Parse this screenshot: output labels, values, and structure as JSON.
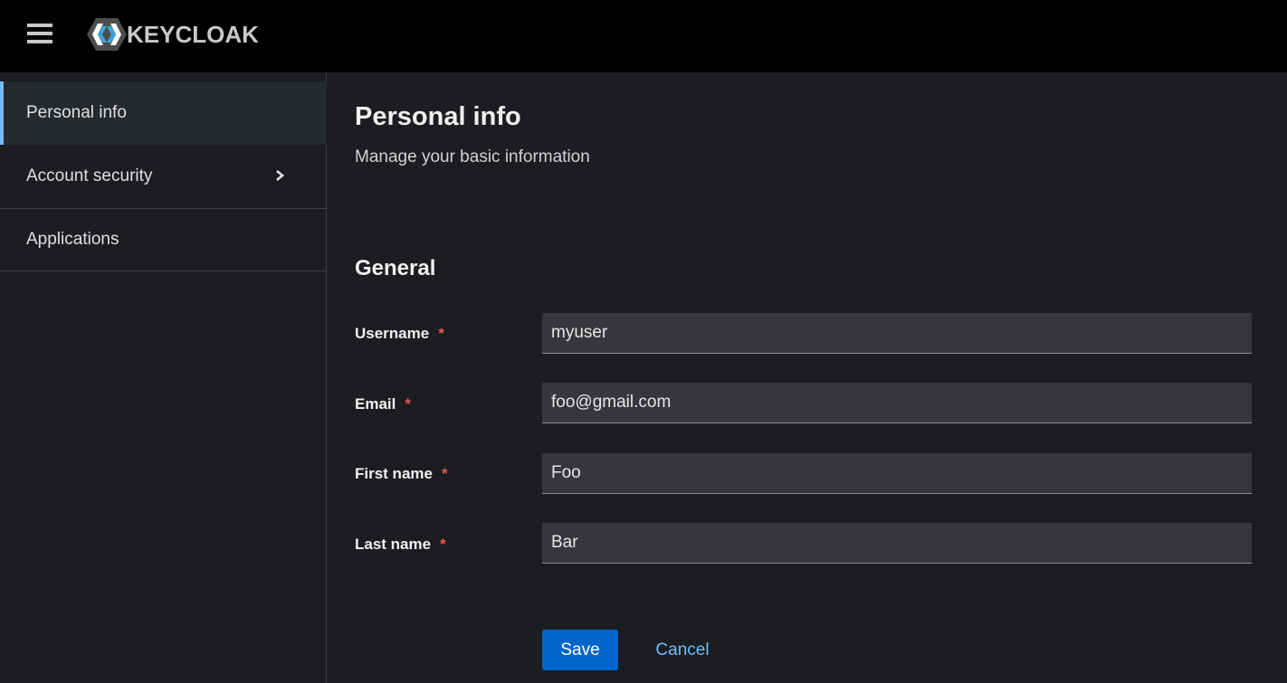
{
  "app": {
    "logo_text": "KEYCLOAK"
  },
  "sidebar": {
    "items": [
      {
        "label": "Personal info",
        "active": true
      },
      {
        "label": "Account security",
        "expandable": true
      },
      {
        "label": "Applications"
      }
    ]
  },
  "main": {
    "title": "Personal info",
    "subtitle": "Manage your basic information",
    "section_title": "General",
    "fields": [
      {
        "label": "Username",
        "required_mark": "*",
        "value": "myuser"
      },
      {
        "label": "Email",
        "required_mark": "*",
        "value": "foo@gmail.com"
      },
      {
        "label": "First name",
        "required_mark": "*",
        "value": "Foo"
      },
      {
        "label": "Last name",
        "required_mark": "*",
        "value": "Bar"
      }
    ],
    "save_label": "Save",
    "cancel_label": "Cancel"
  },
  "colors": {
    "masthead": "#000000",
    "background": "#1b1d21",
    "accent_blue": "#0066cc",
    "link_blue": "#73bcf7",
    "required_red": "#e05a4e"
  },
  "icons": [
    "hamburger-icon",
    "keycloak-logo-icon",
    "chevron-right-icon"
  ]
}
